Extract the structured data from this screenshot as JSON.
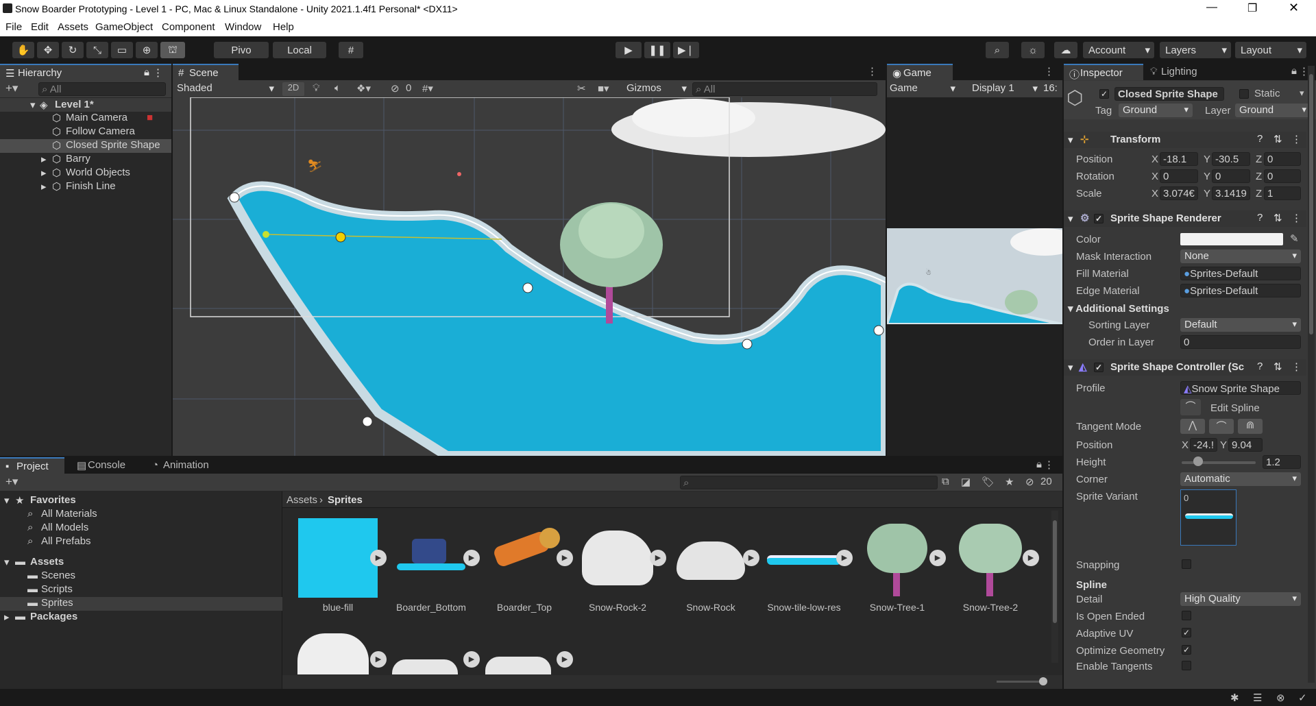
{
  "window": {
    "title": "Snow Boarder Prototyping - Level 1 - PC, Mac & Linux Standalone - Unity 2021.1.4f1 Personal* <DX11>"
  },
  "menu": [
    "File",
    "Edit",
    "Assets",
    "GameObject",
    "Component",
    "Window",
    "Help"
  ],
  "toolbar": {
    "pivot": "Pivo",
    "local": "Local",
    "account": "Account",
    "layers": "Layers",
    "layout": "Layout"
  },
  "hierarchy": {
    "tab": "Hierarchy",
    "search": "All",
    "root": "Level 1*",
    "items": [
      "Main Camera",
      "Follow Camera",
      "Closed Sprite Shape",
      "Barry",
      "World Objects",
      "Finish Line"
    ]
  },
  "scene": {
    "tab": "Scene",
    "shading": "Shaded",
    "mode2d": "2D",
    "hidden_count": "0",
    "gizmos": "Gizmos",
    "search": "All"
  },
  "game": {
    "tab": "Game",
    "view": "Game",
    "display": "Display 1",
    "aspect": "16:"
  },
  "inspector": {
    "tab": "Inspector",
    "lighting": "Lighting",
    "object_name": "Closed Sprite Shape",
    "static": "Static",
    "tag_label": "Tag",
    "tag": "Ground",
    "layer_label": "Layer",
    "layer": "Ground",
    "transform": {
      "title": "Transform",
      "position_label": "Position",
      "rotation_label": "Rotation",
      "scale_label": "Scale",
      "pos": {
        "x": "-18.1",
        "y": "-30.5",
        "z": "0"
      },
      "rot": {
        "x": "0",
        "y": "0",
        "z": "0"
      },
      "scale": {
        "x": "3.074€",
        "y": "3.1419",
        "z": "1"
      }
    },
    "renderer": {
      "title": "Sprite Shape Renderer",
      "color_label": "Color",
      "mask_label": "Mask Interaction",
      "mask": "None",
      "fill_label": "Fill Material",
      "fill": "Sprites-Default",
      "edge_label": "Edge Material",
      "edge": "Sprites-Default",
      "additional": "Additional Settings",
      "sorting_label": "Sorting Layer",
      "sorting": "Default",
      "order_label": "Order in Layer",
      "order": "0"
    },
    "controller": {
      "title": "Sprite Shape Controller (Sc",
      "profile_label": "Profile",
      "profile": "Snow Sprite Shape",
      "edit_spline": "Edit Spline",
      "tangent_label": "Tangent Mode",
      "position_label": "Position",
      "pos_x": "-24.!",
      "pos_y": "9.04",
      "height_label": "Height",
      "height": "1.2",
      "height_fraction": 0.22,
      "corner_label": "Corner",
      "corner": "Automatic",
      "variant_label": "Sprite Variant",
      "variant": "0",
      "snapping": "Snapping",
      "spline": "Spline",
      "detail_label": "Detail",
      "detail": "High Quality",
      "open_ended": "Is Open Ended",
      "adaptive_uv": "Adaptive UV",
      "optimize": "Optimize Geometry",
      "enable_tangents": "Enable Tangents"
    }
  },
  "project": {
    "tabs": [
      "Project",
      "Console",
      "Animation"
    ],
    "hidden_count": "20",
    "favorites": "Favorites",
    "fav_items": [
      "All Materials",
      "All Models",
      "All Prefabs"
    ],
    "assets": "Assets",
    "asset_folders": [
      "Scenes",
      "Scripts",
      "Sprites"
    ],
    "packages": "Packages",
    "breadcrumb": [
      "Assets",
      "Sprites"
    ],
    "files": [
      "blue-fill",
      "Boarder_Bottom",
      "Boarder_Top",
      "Snow-Rock-2",
      "Snow-Rock",
      "Snow-tile-low-res",
      "Snow-Tree-1",
      "Snow-Tree-2"
    ]
  },
  "colors": {
    "accent": "#3a79bb",
    "snow_blue": "#1aaed6",
    "fill_blue": "#1fc8ee"
  }
}
